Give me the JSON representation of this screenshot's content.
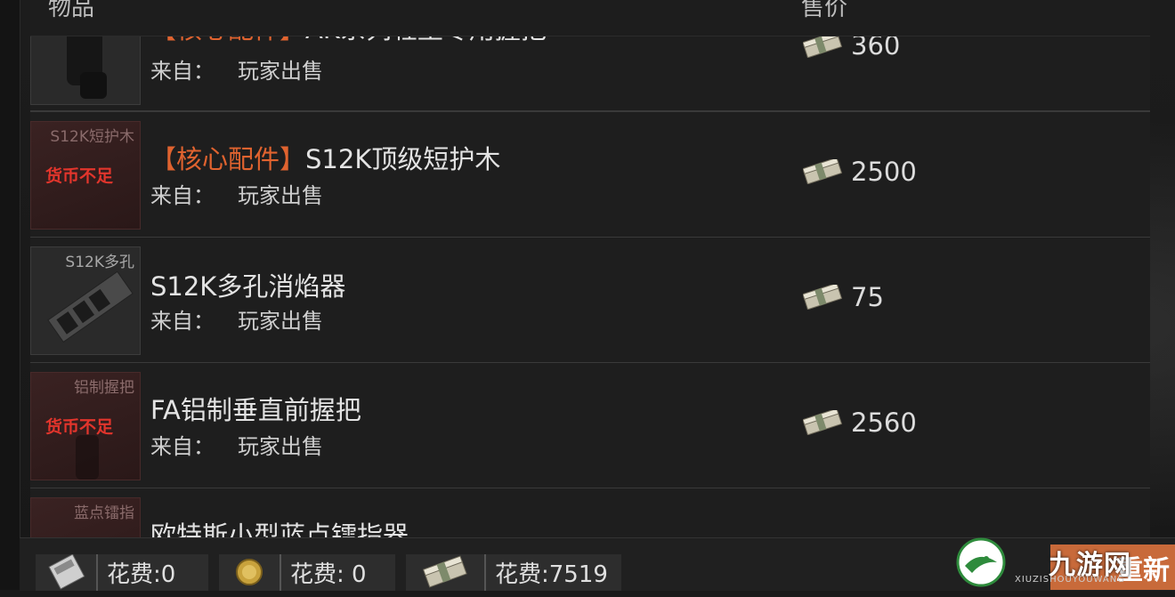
{
  "header": {
    "item_col": "物品",
    "price_col": "售价"
  },
  "from_label": "来自：",
  "rows": [
    {
      "tag": "【核心配件】",
      "name": "AK系列轻型专用握把",
      "thumb_label": "",
      "insufficient": "",
      "from": "玩家出售",
      "price": "360"
    },
    {
      "tag": "【核心配件】",
      "name": "S12K顶级短护木",
      "thumb_label": "S12K短护木",
      "insufficient": "货币不足",
      "from": "玩家出售",
      "price": "2500"
    },
    {
      "tag": "",
      "name": "S12K多孔消焰器",
      "thumb_label": "S12K多孔",
      "insufficient": "",
      "from": "玩家出售",
      "price": "75"
    },
    {
      "tag": "",
      "name": "FA铝制垂直前握把",
      "thumb_label": "铝制握把",
      "insufficient": "货币不足",
      "from": "玩家出售",
      "price": "2560"
    },
    {
      "tag": "",
      "name": "欧特斯小型蓝点镭指器",
      "thumb_label": "蓝点镭指",
      "insufficient": "",
      "from": "",
      "price": ""
    }
  ],
  "footer": {
    "costs": [
      {
        "icon": "card-icon",
        "label": "花费:0"
      },
      {
        "icon": "coin-icon",
        "label": "花费: 0"
      },
      {
        "icon": "cash-icon",
        "label": "花费:7519"
      }
    ],
    "refresh_label": "重新"
  },
  "watermark": {
    "text": "九游网",
    "sub": "XIUZISHOUYOUWANG"
  },
  "colors": {
    "tag": "#e0632f",
    "insufficient": "#e2352c",
    "refresh": "#c86a3a"
  }
}
